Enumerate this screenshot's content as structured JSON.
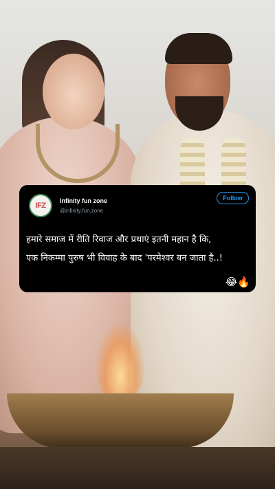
{
  "tweet": {
    "avatar_initials": "IFZ",
    "display_name": "Infinity fun zone",
    "handle": "@infinity.fun.zone",
    "follow_label": "Follow",
    "lines": [
      "हमारे समाज में रीति रिवाज और प्रथाएं इतनी महान है कि,",
      "एक निकम्मा पुरुष भी विवाह के बाद 'परमेश्वर बन जाता है..!"
    ],
    "emojis": "😂🔥"
  },
  "colors": {
    "card_bg": "#000000",
    "follow_accent": "#1d9bf0",
    "handle_gray": "#8b98a5"
  },
  "icons": {
    "avatar": "channel-logo-icon"
  }
}
